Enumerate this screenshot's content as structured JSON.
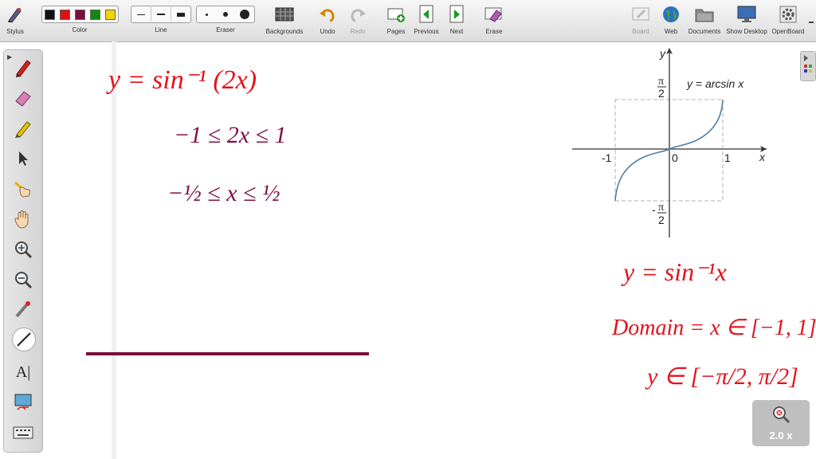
{
  "toolbar": {
    "stylus": "Stylus",
    "color": "Color",
    "line": "Line",
    "eraser": "Eraser",
    "backgrounds": "Backgrounds",
    "undo": "Undo",
    "redo": "Redo",
    "pages": "Pages",
    "previous": "Previous",
    "next": "Next",
    "erase": "Erase",
    "board": "Board",
    "web": "Web",
    "documents": "Documents",
    "show_desktop": "Show Desktop",
    "openboard": "OpenBoard",
    "colors": [
      "#111111",
      "#e01010",
      "#7a0d3c",
      "#0d8a0d",
      "#f2d400"
    ]
  },
  "sidebar": {
    "text_tool": "A|"
  },
  "zoom": {
    "label": "2.0 x"
  },
  "board": {
    "left_notes": {
      "line1": "y = sin⁻¹ (2x)",
      "line2": "−1 ≤ 2x ≤ 1",
      "line3": "−½ ≤ x ≤ ½"
    },
    "graph": {
      "title": "y = arcsin x",
      "y_axis": "y",
      "x_axis": "x",
      "tick_neg1": "-1",
      "tick_0": "0",
      "tick_1": "1",
      "pi_top": "π",
      "two_top": "2",
      "minus": "-",
      "pi_bottom": "π",
      "two_bottom": "2"
    },
    "right_notes": {
      "line1": "y = sin⁻¹x",
      "line2": "Domain = x ∈ [−1, 1]",
      "line3": "y ∈ [−π/2, π/2]"
    }
  }
}
